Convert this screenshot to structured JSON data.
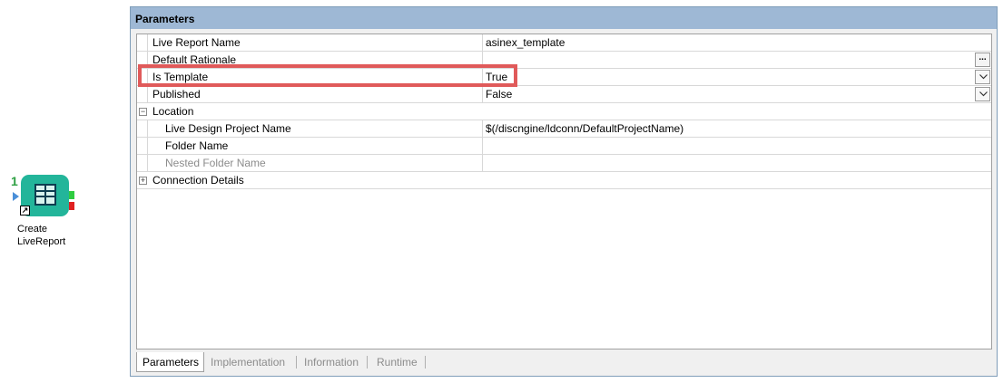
{
  "node": {
    "count": "1",
    "label_line1": "Create",
    "label_line2": "LiveReport",
    "icon": "table-icon",
    "shortcut_icon": "shortcut-arrow-icon",
    "colors": {
      "body": "#23b59a",
      "out_ok": "#2ecc40",
      "out_err": "#e02020"
    }
  },
  "panel": {
    "title": "Parameters",
    "rows": [
      {
        "name": "Live Report Name",
        "value": "asinex_template"
      },
      {
        "name": "Default Rationale",
        "value": "",
        "button": "..."
      },
      {
        "name": "Is Template",
        "value": "True",
        "dropdown": true
      },
      {
        "name": "Published",
        "value": "False",
        "dropdown": true
      },
      {
        "category": "Location",
        "expanded": true,
        "expander": "−"
      },
      {
        "name": "Live Design Project Name",
        "value": "$(/discngine/ldconn/DefaultProjectName)"
      },
      {
        "name": "Folder Name",
        "value": ""
      },
      {
        "name": "Nested Folder Name",
        "value": "",
        "disabled": true
      },
      {
        "category": "Connection Details",
        "expanded": false,
        "expander": "+"
      }
    ],
    "highlight_color": "#e05a5a"
  },
  "tabs": [
    {
      "label": "Parameters",
      "active": true
    },
    {
      "label": "Implementation",
      "active": false
    },
    {
      "label": "Information",
      "active": false
    },
    {
      "label": "Runtime",
      "active": false
    }
  ]
}
